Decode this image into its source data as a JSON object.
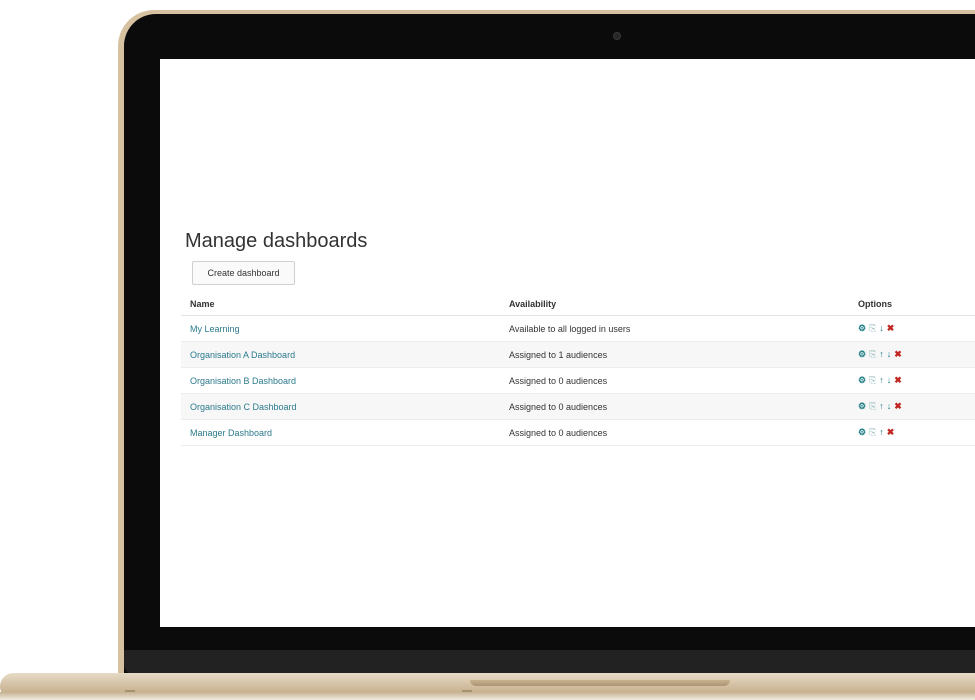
{
  "page": {
    "title": "Manage dashboards",
    "create_label": "Create dashboard"
  },
  "table": {
    "headers": {
      "name": "Name",
      "availability": "Availability",
      "options": "Options"
    },
    "rows": [
      {
        "name": "My Learning",
        "availability": "Available to all logged in users",
        "actions": [
          "edit",
          "clone",
          "down",
          "delete"
        ]
      },
      {
        "name": "Organisation A Dashboard",
        "availability": "Assigned to 1 audiences",
        "actions": [
          "edit",
          "clone",
          "up",
          "down",
          "delete"
        ]
      },
      {
        "name": "Organisation B Dashboard",
        "availability": "Assigned to 0 audiences",
        "actions": [
          "edit",
          "clone",
          "up",
          "down",
          "delete"
        ]
      },
      {
        "name": "Organisation C Dashboard",
        "availability": "Assigned to 0 audiences",
        "actions": [
          "edit",
          "clone",
          "up",
          "down",
          "delete"
        ]
      },
      {
        "name": "Manager Dashboard",
        "availability": "Assigned to 0 audiences",
        "actions": [
          "edit",
          "clone",
          "up",
          "delete"
        ]
      }
    ]
  },
  "icons": {
    "edit": "gear-icon",
    "clone": "copy-icon",
    "up": "arrow-up-icon",
    "down": "arrow-down-icon",
    "delete": "delete-icon"
  },
  "colors": {
    "link": "#2b7a8c",
    "action": "#1d7c84",
    "delete": "#c0261f",
    "laptop_body": "#d6c2a0"
  }
}
